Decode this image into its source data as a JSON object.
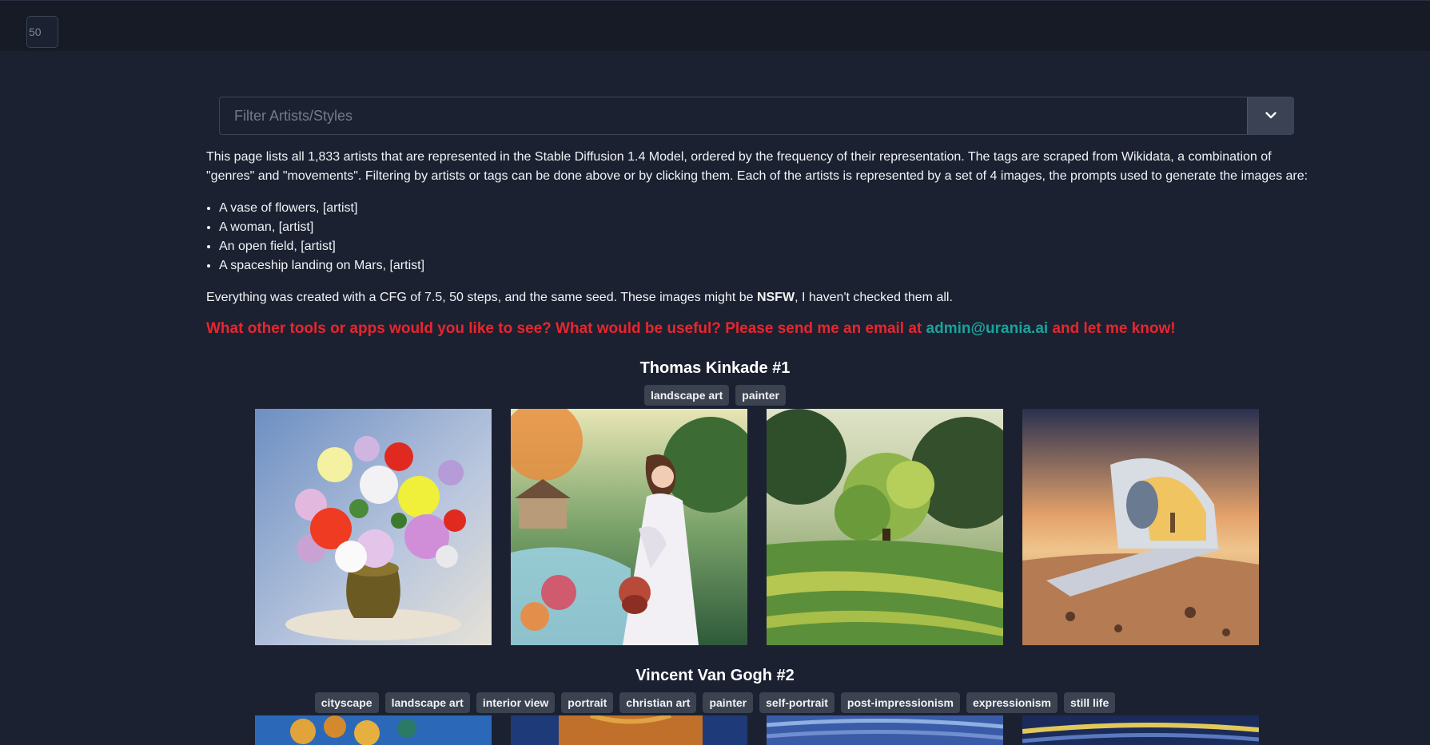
{
  "header": {
    "page_size_value": "50"
  },
  "filter": {
    "placeholder": "Filter Artists/Styles"
  },
  "intro": {
    "paragraph": "This page lists all 1,833 artists that are represented in the Stable Diffusion 1.4 Model, ordered by the frequency of their representation. The tags are scraped from Wikidata, a combination of \"genres\" and \"movements\". Filtering by artists or tags can be done above or by clicking them. Each of the artists is represented by a set of 4 images, the prompts used to generate the images are:",
    "prompts": [
      "A vase of flowers, [artist]",
      "A woman, [artist]",
      "An open field, [artist]",
      "A spaceship landing on Mars, [artist]"
    ],
    "notice_before": "Everything was created with a CFG of 7.5, 50 steps, and the same seed. These images might be ",
    "notice_bold": "NSFW",
    "notice_after": ", I haven't checked them all.",
    "cta_before": "What other tools or apps would you like to see? What would be useful? Please send me an email at ",
    "cta_email": "admin@urania.ai",
    "cta_after": " and let me know!"
  },
  "artists": [
    {
      "name": "Thomas Kinkade #1",
      "tags": [
        "landscape art",
        "painter"
      ],
      "images": [
        "vase-of-flowers",
        "woman",
        "open-field",
        "spaceship-on-mars"
      ]
    },
    {
      "name": "Vincent Van Gogh #2",
      "tags": [
        "cityscape",
        "landscape art",
        "interior view",
        "portrait",
        "christian art",
        "painter",
        "self-portrait",
        "post-impressionism",
        "expressionism",
        "still life"
      ],
      "images": [
        "vase-of-flowers",
        "woman",
        "open-field",
        "spaceship-on-mars"
      ]
    }
  ],
  "colors": {
    "background": "#1b2131",
    "topbar": "#171b26",
    "cta_red": "#e8262e",
    "link_teal": "#1aa39a",
    "tag_bg": "#3b4250"
  }
}
